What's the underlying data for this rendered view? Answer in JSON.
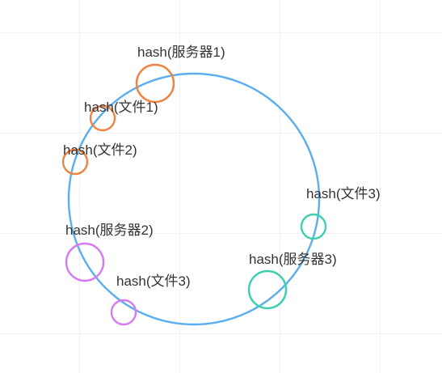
{
  "ring": {
    "color": "#5aaef0"
  },
  "nodes": [
    {
      "id": "server-1",
      "label": "hash(服务器1)",
      "color": "#f0823f"
    },
    {
      "id": "file-1",
      "label": "hash(文件1)",
      "color": "#f0823f"
    },
    {
      "id": "file-2",
      "label": "hash(文件2)",
      "color": "#f0823f"
    },
    {
      "id": "file-3a",
      "label": "hash(文件3)",
      "color": "#3ecfb0"
    },
    {
      "id": "server-2",
      "label": "hash(服务器2)",
      "color": "#d57bf0"
    },
    {
      "id": "server-3",
      "label": "hash(服务器3)",
      "color": "#3ecfb0"
    },
    {
      "id": "file-3b",
      "label": "hash(文件3)",
      "color": "#d57bf0"
    }
  ]
}
